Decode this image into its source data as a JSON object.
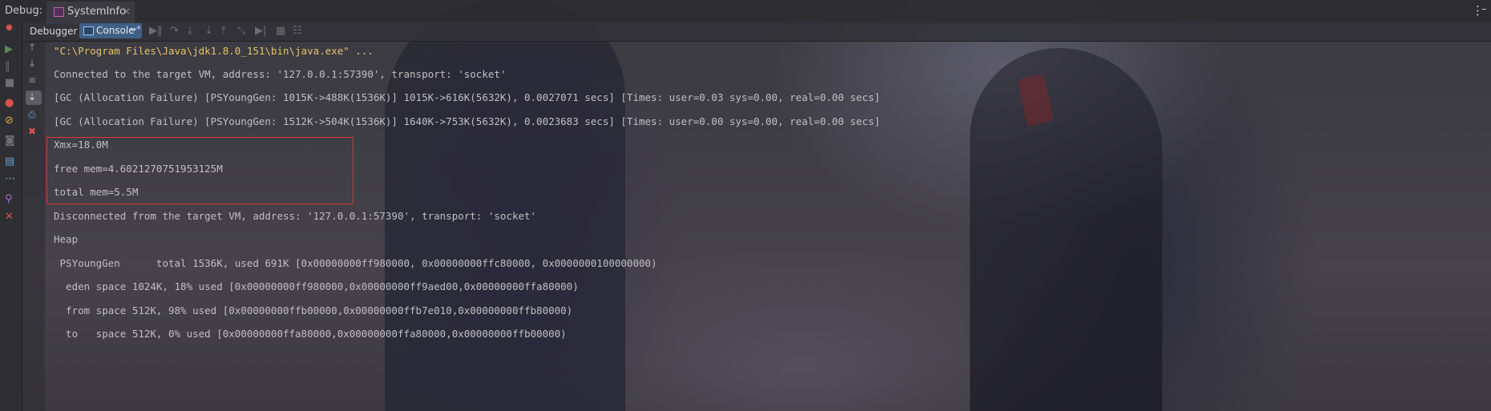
{
  "app": {
    "debug_label": "Debug:",
    "tab_title": "SystemInfo",
    "tab_close": "×",
    "menu_glyph": "⋮",
    "minimize_glyph": "–"
  },
  "toolbar": {
    "debugger_label": "Debugger",
    "console_label": "Console",
    "console_arrow": "→*"
  },
  "console": {
    "lines": [
      "\"C:\\Program Files\\Java\\jdk1.8.0_151\\bin\\java.exe\" ...",
      "Connected to the target VM, address: '127.0.0.1:57390', transport: 'socket'",
      "[GC (Allocation Failure) [PSYoungGen: 1015K->488K(1536K)] 1015K->616K(5632K), 0.0027071 secs] [Times: user=0.03 sys=0.00, real=0.00 secs]",
      "[GC (Allocation Failure) [PSYoungGen: 1512K->504K(1536K)] 1640K->753K(5632K), 0.0023683 secs] [Times: user=0.00 sys=0.00, real=0.00 secs]",
      "Xmx=18.0M",
      "free mem=4.6021270751953125M",
      "total mem=5.5M",
      "Disconnected from the target VM, address: '127.0.0.1:57390', transport: 'socket'",
      "Heap",
      " PSYoungGen      total 1536K, used 691K [0x00000000ff980000, 0x00000000ffc80000, 0x0000000100000000)",
      "  eden space 1024K, 18% used [0x00000000ff980000,0x00000000ff9aed00,0x00000000ffa80000)",
      "  from space 512K, 98% used [0x00000000ffb00000,0x00000000ffb7e010,0x00000000ffb80000)",
      "  to   space 512K, 0% used [0x00000000ffa80000,0x00000000ffa80000,0x00000000ffb00000)"
    ]
  },
  "colors": {
    "command_text": "#e8c46a",
    "output_text": "#c0bfc4",
    "highlight_border": "#d8363a",
    "console_tab": "#3f5f86"
  },
  "icons": {
    "left_strip": [
      "bug-icon",
      "resume-icon",
      "pause-icon",
      "stop-icon",
      "view-breakpoints-icon",
      "mute-breakpoints-icon",
      "camera-icon",
      "layout-icon",
      "more-icon",
      "pin-icon",
      "close-icon"
    ],
    "gutter": [
      "up-arrow-icon",
      "down-arrow-icon",
      "soft-wrap-icon",
      "scroll-to-end-icon",
      "print-icon",
      "trash-icon"
    ]
  }
}
